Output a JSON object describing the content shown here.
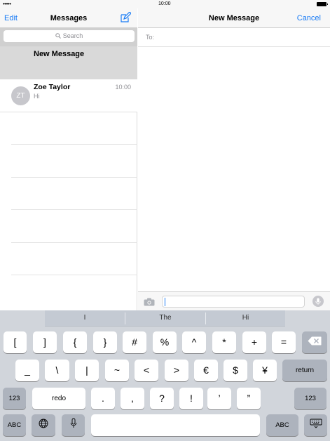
{
  "status_bar": {
    "signal": "•••••",
    "time": "10:00"
  },
  "messages_list": {
    "nav": {
      "edit_label": "Edit",
      "title": "Messages",
      "compose_icon": "compose-icon"
    },
    "search": {
      "placeholder": "Search"
    },
    "items": [
      {
        "title": "New Message",
        "selected": true
      },
      {
        "name": "Zoe Taylor",
        "initials": "ZT",
        "time": "10:00",
        "preview": "Hi"
      }
    ]
  },
  "conversation": {
    "nav": {
      "title": "New Message",
      "cancel_label": "Cancel"
    },
    "to_label": "To:",
    "input_value": ""
  },
  "keyboard": {
    "suggestions": [
      "I",
      "The",
      "Hi"
    ],
    "row1": [
      "[",
      "]",
      "{",
      "}",
      "#",
      "%",
      "^",
      "*",
      "+",
      "="
    ],
    "row2": [
      "_",
      "\\",
      "|",
      "~",
      "<",
      ">",
      "€",
      "$",
      "¥"
    ],
    "row2_return": "return",
    "row3_left": "123",
    "row3_redo": "redo",
    "row3": [
      ".",
      ",",
      "?",
      "!",
      "’",
      "”"
    ],
    "row3_right": "123",
    "row4_abc_left": "ABC",
    "row4_abc_right": "ABC"
  },
  "colors": {
    "accent": "#1a7cf5",
    "keyboard_bg": "#d1d5db",
    "function_key": "#adb3bd"
  }
}
